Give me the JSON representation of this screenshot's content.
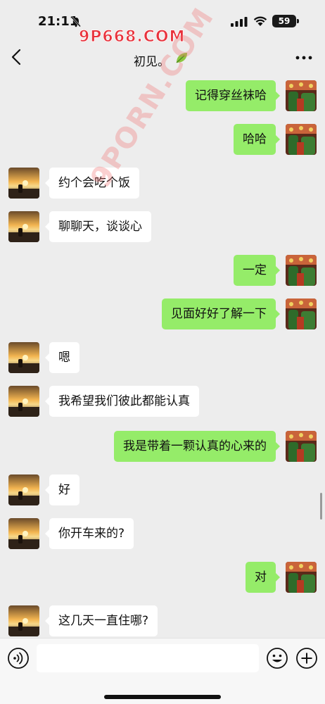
{
  "status_bar": {
    "time": "21:11",
    "battery": "59"
  },
  "watermark_top": "9P668.COM",
  "watermark_diag": "9PORN.COM",
  "nav": {
    "title": "初见。"
  },
  "messages": [
    {
      "side": "right",
      "text": "记得穿丝袜哈"
    },
    {
      "side": "right",
      "text": "哈哈"
    },
    {
      "side": "left",
      "text": "约个会吃个饭"
    },
    {
      "side": "left",
      "text": "聊聊天，谈谈心"
    },
    {
      "side": "right",
      "text": "一定"
    },
    {
      "side": "right",
      "text": "见面好好了解一下"
    },
    {
      "side": "left",
      "text": "嗯"
    },
    {
      "side": "left",
      "text": "我希望我们彼此都能认真"
    },
    {
      "side": "right",
      "text": "我是带着一颗认真的心来的"
    },
    {
      "side": "left",
      "text": "好"
    },
    {
      "side": "left",
      "text": "你开车来的?"
    },
    {
      "side": "right",
      "text": "对"
    },
    {
      "side": "left",
      "text": "这几天一直住哪?"
    }
  ],
  "input": {
    "value": "",
    "placeholder": ""
  },
  "colors": {
    "background": "#ededed",
    "sent_bubble": "#95ec69",
    "received_bubble": "#ffffff",
    "input_bar": "#f7f7f7"
  },
  "icons": [
    "bell-slash-icon",
    "signal-icon",
    "wifi-icon",
    "back-chevron-icon",
    "leaf-icon",
    "more-dots-icon",
    "voice-icon",
    "emoji-icon",
    "plus-icon"
  ]
}
